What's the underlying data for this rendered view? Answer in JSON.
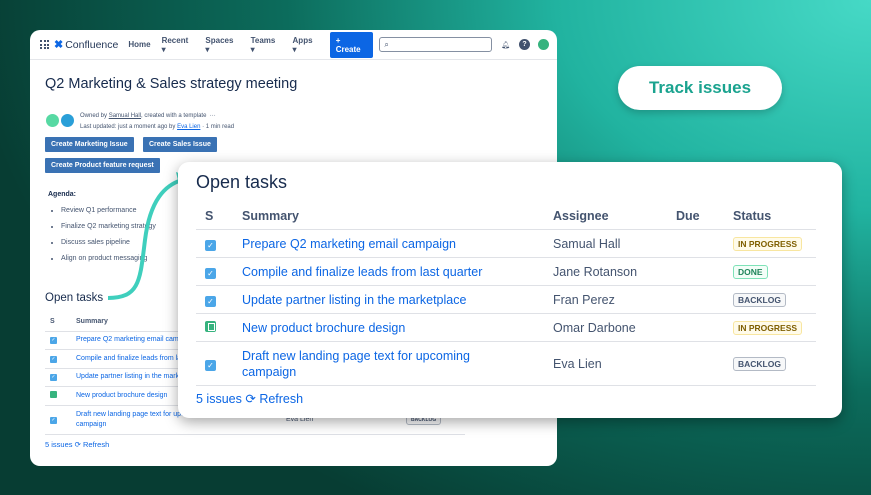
{
  "nav": {
    "product": "Confluence",
    "items": [
      "Home",
      "Recent",
      "Spaces",
      "Teams",
      "Apps"
    ],
    "create": "+ Create",
    "search_placeholder": ""
  },
  "page": {
    "title": "Q2 Marketing & Sales strategy meeting",
    "owned_prefix": "Owned by ",
    "owner": "Samual Hall",
    "owned_suffix": ", created with a template",
    "more": "···",
    "updated_prefix": "Last updated: just a moment ago by ",
    "updated_by": "Eva Lien",
    "updated_suffix": " · 1 min read",
    "buttons": [
      "Create Marketing Issue",
      "Create Sales Issue",
      "Create Product feature request"
    ],
    "agenda_label": "Agenda:",
    "agenda": [
      "Review Q1 performance",
      "Finalize Q2 marketing strategy",
      "Discuss sales pipeline",
      "Align on product messaging"
    ]
  },
  "tasks": {
    "title": "Open tasks",
    "columns": [
      "S",
      "Summary",
      "Assignee",
      "Due",
      "Status"
    ],
    "rows": [
      {
        "type": "task",
        "summary": "Prepare Q2 marketing email campaign",
        "assignee": "Samual Hall",
        "due": "",
        "status": "IN PROGRESS"
      },
      {
        "type": "task",
        "summary": "Compile and finalize leads from last quarter",
        "assignee": "Jane Rotanson",
        "due": "",
        "status": "DONE"
      },
      {
        "type": "task",
        "summary": "Update partner listing in the marketplace",
        "assignee": "Fran Perez",
        "due": "",
        "status": "BACKLOG"
      },
      {
        "type": "story",
        "summary": "New product brochure design",
        "assignee": "Omar Darbone",
        "due": "",
        "status": "IN PROGRESS"
      },
      {
        "type": "task",
        "summary": "Draft new landing page text for upcoming campaign",
        "assignee": "Eva Lien",
        "due": "",
        "status": "BACKLOG"
      }
    ],
    "count": "5 issues",
    "refresh": "Refresh"
  },
  "callout": "Track issues",
  "colors": {
    "accent": "#0c66e4",
    "teal": "#1aa38f"
  }
}
